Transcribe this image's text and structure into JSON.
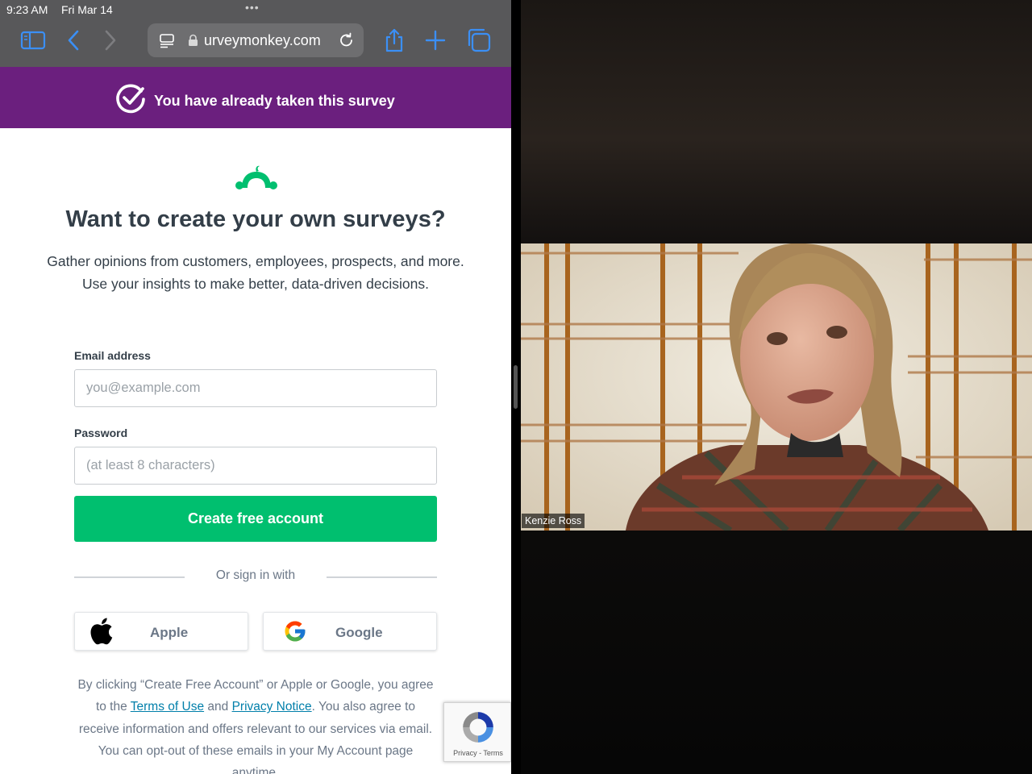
{
  "status_bar": {
    "time": "9:23 AM",
    "date": "Fri Mar 14",
    "multitask": "•••"
  },
  "browser": {
    "url": "urveymonkey.com"
  },
  "banner": {
    "message": "You have already taken this survey"
  },
  "promo": {
    "title": "Want to create your own surveys?",
    "line1": "Gather opinions from customers, employees, prospects, and more.",
    "line2": "Use your insights to make better, data-driven decisions."
  },
  "form": {
    "email_label": "Email address",
    "email_placeholder": "you@example.com",
    "password_label": "Password",
    "password_placeholder": "(at least 8 characters)",
    "submit_label": "Create free account",
    "divider_text": "Or sign in with",
    "apple_label": "Apple",
    "google_label": "Google"
  },
  "legal": {
    "part1": "By clicking “Create Free Account” or Apple or Google, you agree to the ",
    "terms_link": "Terms of Use",
    "and": " and ",
    "privacy_link": "Privacy Notice",
    "part2": ". You also agree to receive information and offers relevant to our services via email. You can opt-out of these emails in your My Account page anytime."
  },
  "recaptcha": {
    "label": "Privacy - Terms"
  },
  "video": {
    "participant_name": "Kenzie Ross"
  },
  "colors": {
    "banner": "#6b1f7e",
    "brand_green": "#00bf6f",
    "link": "#007faa",
    "safari_blue": "#3b8ff5"
  }
}
